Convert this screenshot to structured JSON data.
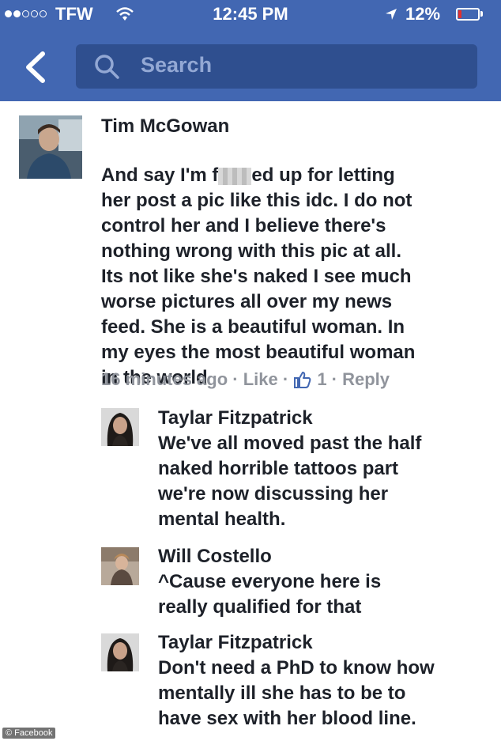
{
  "status_bar": {
    "carrier": "TFW",
    "time": "12:45 PM",
    "battery": "12%"
  },
  "nav": {
    "search_placeholder": "Search"
  },
  "comment": {
    "author": "Tim McGowan",
    "text_before": "And say I'm f",
    "text_after": "ed up for letting",
    "text_rest": "her post a pic like this idc. I do not\ncontrol her and I believe there's\nnothing wrong with this pic at all.\nIts not like she's naked I see much\nworse pictures all over my news\nfeed. She is a beautiful woman. In\nmy eyes the most beautiful woman\nin the world",
    "timestamp": "16 minutes ago",
    "sep1": " · ",
    "like": "Like",
    "sep2": " · ",
    "likes_count": "1",
    "sep3": " · ",
    "reply": "Reply"
  },
  "replies": [
    {
      "author": "Taylar Fitzpatrick",
      "text": "We've all moved past the half\nnaked horrible tattoos part\nwe're now discussing her\nmental health."
    },
    {
      "author": "Will Costello",
      "text": "^Cause everyone here is\nreally qualified for that"
    },
    {
      "author": "Taylar Fitzpatrick",
      "text": "Don't need a PhD to know how\nmentally ill she has to be to\nhave sex with her blood line."
    }
  ],
  "watermark": "© Facebook",
  "colors": {
    "header": "#4267b2",
    "search_box": "#2f4f8f",
    "text": "#1d2129",
    "meta": "#90949c",
    "like_blue": "#4267b2"
  }
}
